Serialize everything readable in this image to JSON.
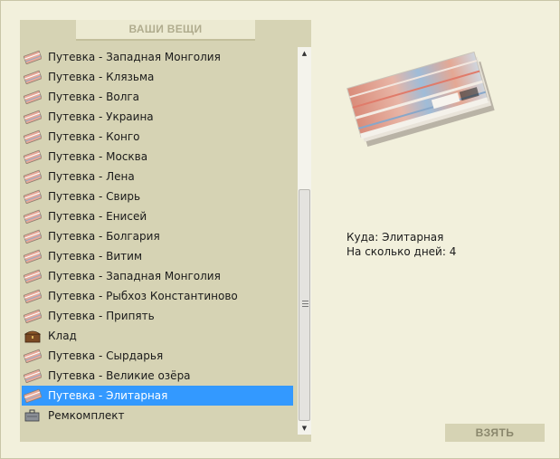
{
  "panel": {
    "title": "ВАШИ ВЕЩИ"
  },
  "items": [
    {
      "label": "Путевка - Западная Монголия",
      "icon": "ticket-icon"
    },
    {
      "label": "Путевка - Клязьма",
      "icon": "ticket-icon"
    },
    {
      "label": "Путевка - Волга",
      "icon": "ticket-icon"
    },
    {
      "label": "Путевка - Украина",
      "icon": "ticket-icon"
    },
    {
      "label": "Путевка - Конго",
      "icon": "ticket-icon"
    },
    {
      "label": "Путевка - Москва",
      "icon": "ticket-icon"
    },
    {
      "label": "Путевка - Лена",
      "icon": "ticket-icon"
    },
    {
      "label": "Путевка - Свирь",
      "icon": "ticket-icon"
    },
    {
      "label": "Путевка - Енисей",
      "icon": "ticket-icon"
    },
    {
      "label": "Путевка - Болгария",
      "icon": "ticket-icon"
    },
    {
      "label": "Путевка - Витим",
      "icon": "ticket-icon"
    },
    {
      "label": "Путевка - Западная Монголия",
      "icon": "ticket-icon"
    },
    {
      "label": "Путевка - Рыбхоз Константиново",
      "icon": "ticket-icon"
    },
    {
      "label": "Путевка - Припять",
      "icon": "ticket-icon"
    },
    {
      "label": "Клад",
      "icon": "chest-icon"
    },
    {
      "label": "Путевка - Сырдарья",
      "icon": "ticket-icon"
    },
    {
      "label": "Путевка - Великие озёра",
      "icon": "ticket-icon"
    },
    {
      "label": "Путевка - Элитарная",
      "icon": "ticket-icon",
      "selected": true
    },
    {
      "label": "Ремкомплект",
      "icon": "repair-kit-icon"
    }
  ],
  "details": {
    "destination": "Куда: Элитарная",
    "days": "На сколько дней: 4"
  },
  "actions": {
    "take_label": "ВЗЯТЬ"
  },
  "colors": {
    "selection": "#3399ff",
    "panel": "#d6d3b4",
    "background": "#f2f0dc"
  }
}
